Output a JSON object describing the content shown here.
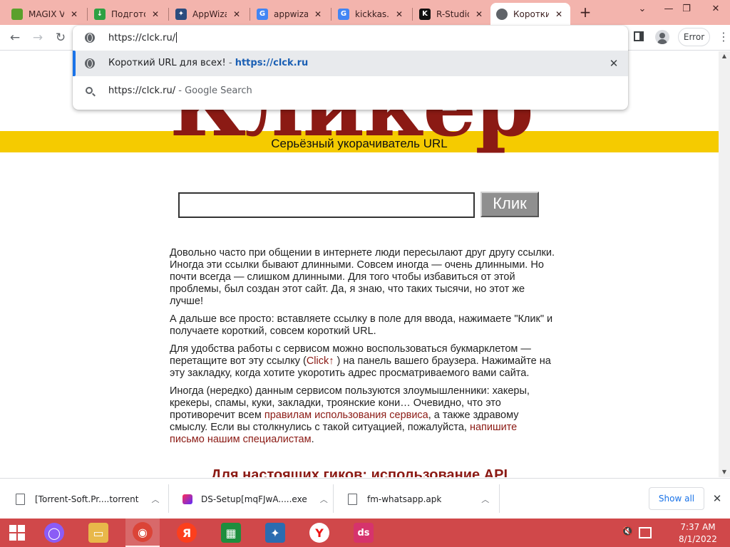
{
  "browser": {
    "tabs": [
      {
        "title": "MAGIX V",
        "icon": "magix-icon",
        "color": "#5aa02c",
        "glyph": ""
      },
      {
        "title": "Подгото",
        "icon": "download-icon",
        "color": "#2ea043",
        "glyph": "↓"
      },
      {
        "title": "AppWiza",
        "icon": "appwizard-icon",
        "color": "#2b4c7e",
        "glyph": "✦"
      },
      {
        "title": "appwizar",
        "icon": "google-icon",
        "color": "#4285f4",
        "glyph": "G"
      },
      {
        "title": "kickkas.b",
        "icon": "google-icon",
        "color": "#4285f4",
        "glyph": "G"
      },
      {
        "title": "R-Studio",
        "icon": "r-studio-icon",
        "color": "#111111",
        "glyph": "K"
      },
      {
        "title": "Коротки",
        "icon": "globe-icon",
        "color": "#5f6368",
        "glyph": ""
      }
    ],
    "active_tab": 6,
    "omnibox": {
      "input_text": "https://clck.ru/",
      "suggestions": [
        {
          "title": "Короткий URL для всех!",
          "separator": " - ",
          "url": "https://clck.ru"
        },
        {
          "query": "https://clck.ru/",
          "separator": " - ",
          "engine": "Google Search"
        }
      ]
    },
    "profile_chip": "Error"
  },
  "page": {
    "logo_text": "Кликер",
    "tagline": "Серьёзный укорачиватель URL",
    "button_label": "Клик",
    "paragraphs": {
      "p1": "Довольно часто при общении в интернете люди пересылают друг другу ссылки. Иногда эти ссылки бывают длинными. Совсем иногда — очень длинными. Но почти всегда — слишком длинными. Для того чтобы избавиться от этой проблемы, был создан этот сайт. Да, я знаю, что таких тысячи, но этот же лучше!",
      "p2": "А дальше все просто: вставляете ссылку в поле для ввода, нажимаете \"Клик\" и получаете короткий, совсем короткий URL.",
      "p3_before": "Для удобства работы с сервисом можно воспользоваться букмарклетом — перетащите вот эту ссылку (",
      "p3_link": "Click↑",
      "p3_after": " ) на панель вашего браузера. Нажимайте на эту закладку, когда хотите укоротить адрес просматриваемого вами сайта.",
      "p4_before": "Иногда (нередко) данным сервисом пользуются злоумышленники: хакеры, крекеры, спамы, куки, закладки, троянские кони… Очевидно, что это противоречит всем ",
      "p4_link1": "правилам использования сервиса",
      "p4_middle": ", а также здравому смыслу. Если вы столкнулись с такой ситуацией, пожалуйста, ",
      "p4_link2": "напишите письмо нашим специалистам",
      "p4_end": "."
    },
    "api_heading": "Для настоящих гиков: использование API"
  },
  "downloads": {
    "items": [
      {
        "name": "[Torrent-Soft.Pr....torrent",
        "icon": "file-icon"
      },
      {
        "name": "DS-Setup[mqFJwA.....exe",
        "icon": "ds-icon"
      },
      {
        "name": "fm-whatsapp.apk",
        "icon": "file-icon"
      }
    ],
    "show_all": "Show all"
  },
  "taskbar": {
    "apps": [
      {
        "name": "alice-icon",
        "color": "#8b5cf6",
        "glyph": "◯"
      },
      {
        "name": "file-explorer-icon",
        "color": "#e8b84a",
        "glyph": "▭"
      },
      {
        "name": "chrome-icon",
        "color": "#db4437",
        "glyph": "◉"
      },
      {
        "name": "yandex-icon",
        "color": "#fc3f1d",
        "glyph": "Я"
      },
      {
        "name": "spreadsheet-icon",
        "color": "#1e8e3e",
        "glyph": "▦"
      },
      {
        "name": "appwizard-icon",
        "color": "#2b6cb0",
        "glyph": "✦"
      },
      {
        "name": "yandex-browser-icon",
        "color": "#ffffff",
        "glyph": "Y"
      },
      {
        "name": "ds-icon",
        "color": "#d6336c",
        "glyph": "ds"
      }
    ],
    "active_app": 2,
    "time": "7:37 AM",
    "date": "8/1/2022"
  }
}
